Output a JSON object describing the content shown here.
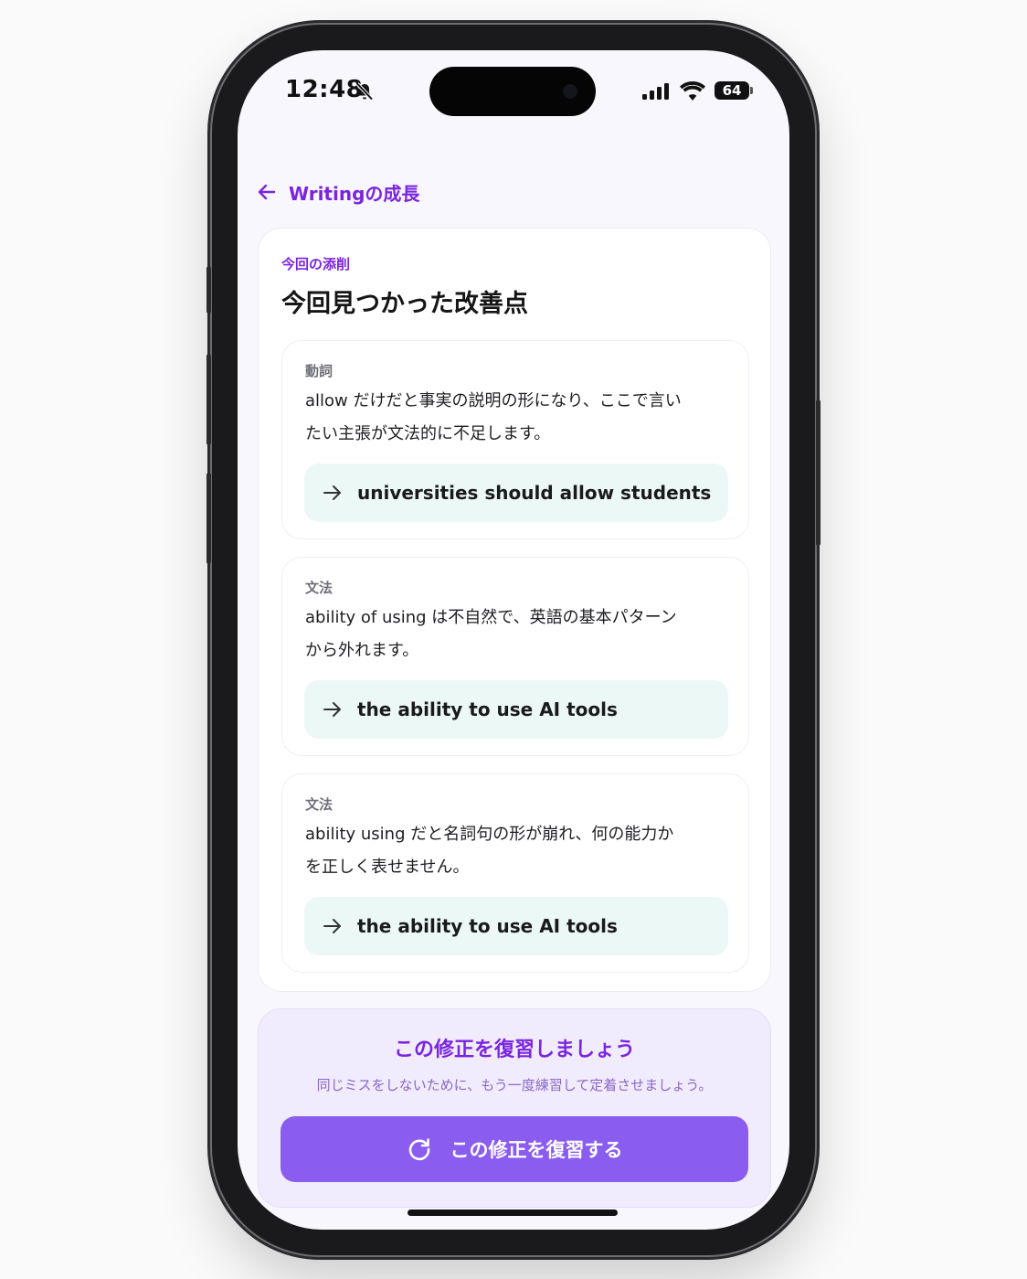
{
  "status_bar": {
    "time": "12:48",
    "battery": "64",
    "icons": [
      "bell-slash-icon",
      "cellular-signal-icon",
      "wifi-icon",
      "battery-icon"
    ]
  },
  "nav": {
    "back_icon": "arrow-left-icon",
    "title": "Writingの成長"
  },
  "card": {
    "kicker": "今回の添削",
    "title": "今回見つかった改善点",
    "items": [
      {
        "category": "動詞",
        "line1": "allow だけだと事実の説明の形になり、ここで言い",
        "line2": "たい主張が文法的に不足します。",
        "correction": "universities should allow students"
      },
      {
        "category": "文法",
        "line1": "ability of using は不自然で、英語の基本パターン",
        "line2": "から外れます。",
        "correction": "the ability to use AI tools"
      },
      {
        "category": "文法",
        "line1": "ability using だと名詞句の形が崩れ、何の能力か",
        "line2": "を正しく表せません。",
        "correction": "the ability to use AI tools"
      }
    ]
  },
  "review": {
    "title": "この修正を復習しましょう",
    "subtitle": "同じミスをしないために、もう一度練習して定着させましょう。",
    "button_label": "この修正を復習する",
    "button_icon": "refresh-icon"
  },
  "colors": {
    "accent": "#7a24e0",
    "button": "#8b5cf0",
    "correction_bg": "#ecf8f6",
    "review_bg": "#f1ecfd"
  }
}
